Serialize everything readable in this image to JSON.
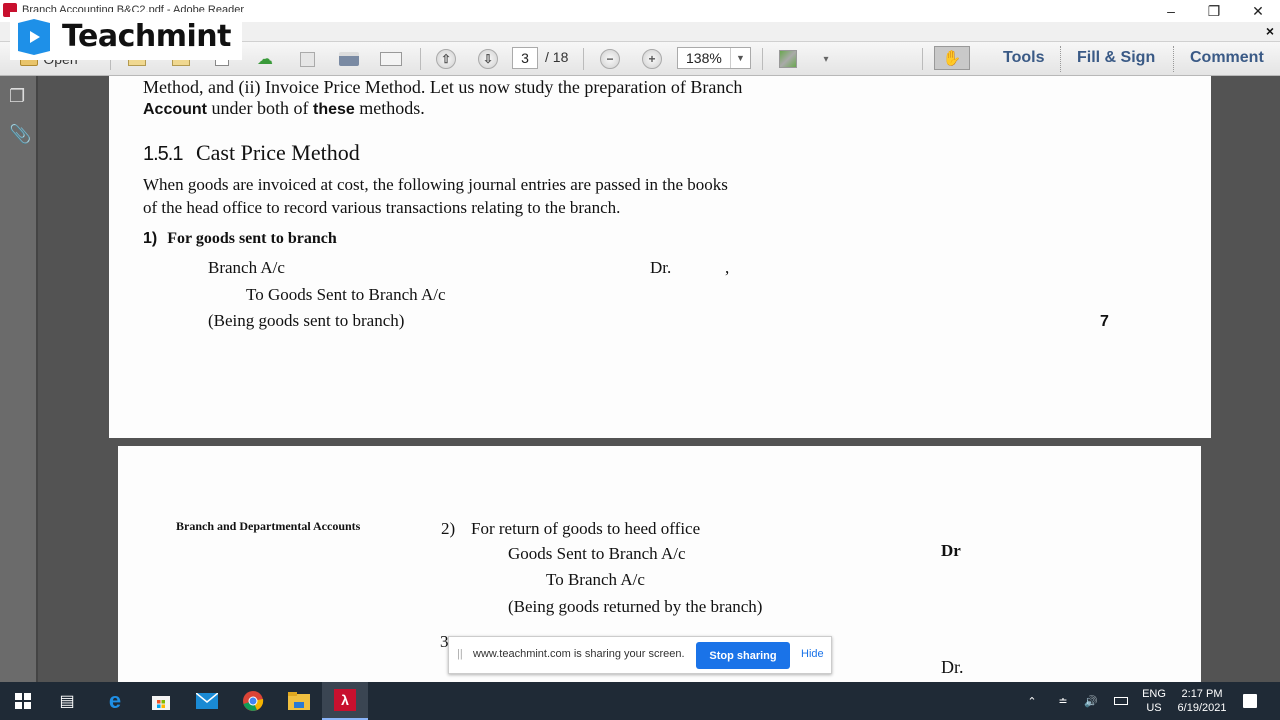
{
  "window": {
    "title": "Branch Accounting B&C2.pdf - Adobe Reader",
    "minimize_icon": "minimize-icon",
    "restore_icon": "restore-icon",
    "close_icon": "close-icon"
  },
  "overlay": {
    "brand": "Teachmint"
  },
  "toolbar": {
    "open_label": "Open",
    "page_current": "3",
    "page_total": "/ 18",
    "zoom_value": "138%",
    "tools_label": "Tools",
    "fill_sign_label": "Fill & Sign",
    "comment_label": "Comment",
    "close_doc": "×"
  },
  "page1": {
    "line1": "Method, and (ii) Invoice Price Method. Let us now study the preparation of Branch",
    "line2_bold1": "Account",
    "line2_mid": " under both of ",
    "line2_bold2": "these",
    "line2_end": " methods.",
    "heading_num": "1.5.1",
    "heading_text": "Cast Price Method",
    "para1": "When goods are invoiced at cost, the following journal entries are passed in the books",
    "para2": "of the head office to record various transactions relating to the branch.",
    "entry1_num": "1)",
    "entry1_title": "For goods sent to branch",
    "entry1_debit": "Branch A/c",
    "entry1_dr": "Dr.",
    "entry1_comma": ",",
    "entry1_credit": "To Goods Sent to Branch A/c",
    "entry1_narration": "(Being goods sent to branch)",
    "margin_note": "7"
  },
  "page2": {
    "running_header": "Branch and Departmental Accounts",
    "entry2_num": "2)",
    "entry2_title": "For return of goods to heed office",
    "entry2_debit": "Goods Sent to Branch A/c",
    "entry2_dr": "Dr",
    "entry2_credit": "To Branch A/c",
    "entry2_narration": "(Being goods returned by the branch)",
    "entry3_num": "3",
    "entry3_dr": "Dr."
  },
  "share_notice": {
    "message": "www.teachmint.com is sharing your screen.",
    "stop_label": "Stop sharing",
    "hide_label": "Hide"
  },
  "taskbar": {
    "lang_top": "ENG",
    "lang_bottom": "US",
    "time": "2:17 PM",
    "date": "6/19/2021"
  }
}
